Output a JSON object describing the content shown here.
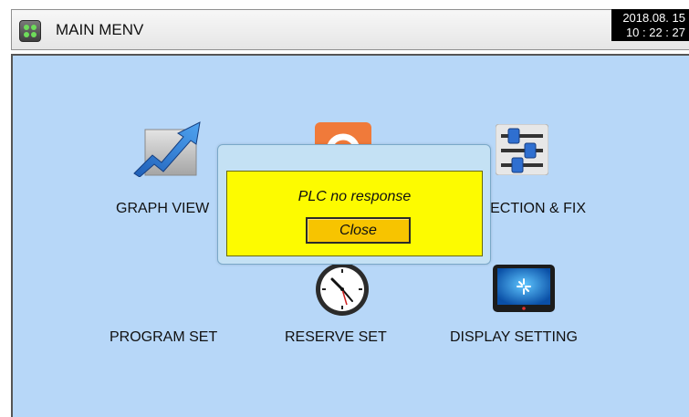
{
  "header": {
    "title": "MAIN MENV",
    "date": "2018.08. 15",
    "time": "10 : 22 : 27"
  },
  "menu": {
    "graph_view": "GRAPH VIEW",
    "correction_fix": "CORRECTION & FIX",
    "program_set": "PROGRAM SET",
    "reserve_set": "RESERVE SET",
    "display_setting": "DISPLAY SETTING",
    "icons": [
      "graph-icon",
      "refresh-icon",
      "sliders-icon",
      "clock-icon",
      "display-icon"
    ]
  },
  "dialog": {
    "message": "PLC no response",
    "close_label": "Close"
  },
  "colors": {
    "panel": "#b7d7f8",
    "dialog_fill": "#fdfb00",
    "close_button": "#f7c400"
  }
}
